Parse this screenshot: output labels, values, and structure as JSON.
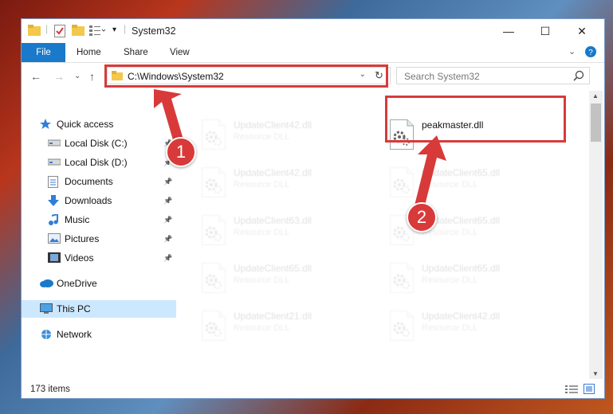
{
  "window": {
    "title": "System32",
    "controls": {
      "minimize": "—",
      "maximize": "☐",
      "close": "✕"
    }
  },
  "ribbon": {
    "tabs": [
      "File",
      "Home",
      "Share",
      "View"
    ]
  },
  "address_bar": {
    "path": "C:\\Windows\\System32"
  },
  "search": {
    "placeholder": "Search System32"
  },
  "sidebar": {
    "items": [
      {
        "label": "Quick access",
        "icon": "star-icon",
        "pinned": false
      },
      {
        "label": "Local Disk (C:)",
        "icon": "drive-icon",
        "pinned": true
      },
      {
        "label": "Local Disk (D:)",
        "icon": "drive-icon",
        "pinned": true
      },
      {
        "label": "Documents",
        "icon": "documents-icon",
        "pinned": true
      },
      {
        "label": "Downloads",
        "icon": "download-icon",
        "pinned": true
      },
      {
        "label": "Music",
        "icon": "music-icon",
        "pinned": true
      },
      {
        "label": "Pictures",
        "icon": "pictures-icon",
        "pinned": true
      },
      {
        "label": "Videos",
        "icon": "videos-icon",
        "pinned": true
      },
      {
        "label": "OneDrive",
        "icon": "cloud-icon",
        "pinned": false
      },
      {
        "label": "This PC",
        "icon": "computer-icon",
        "pinned": false,
        "selected": true
      },
      {
        "label": "Network",
        "icon": "network-icon",
        "pinned": false
      }
    ]
  },
  "files": {
    "highlighted": {
      "name": "peakmaster.dll",
      "type": ""
    },
    "left_column": [
      {
        "name": "UpdateClient42.dll",
        "type": "Resource DLL"
      },
      {
        "name": "UpdateClient42.dll",
        "type": "Resource DLL"
      },
      {
        "name": "UpdateClient63.dll",
        "type": "Resource DLL"
      },
      {
        "name": "UpdateClient65.dll",
        "type": "Resource DLL"
      },
      {
        "name": "UpdateClient21.dll",
        "type": "Resource DLL"
      }
    ],
    "right_column": [
      {
        "name": "UpdateClient65.dll",
        "type": "Resource DLL"
      },
      {
        "name": "UpdateClient65.dll",
        "type": "Resource DLL"
      },
      {
        "name": "UpdateClient65.dll",
        "type": "Resource DLL"
      },
      {
        "name": "UpdateClient42.dll",
        "type": "Resource DLL"
      }
    ]
  },
  "status_bar": {
    "item_count": "173 items"
  },
  "callouts": {
    "one": "1",
    "two": "2"
  },
  "colors": {
    "accent": "#1979ca",
    "highlight": "#d83a3a",
    "selected_bg": "#cce8ff"
  }
}
